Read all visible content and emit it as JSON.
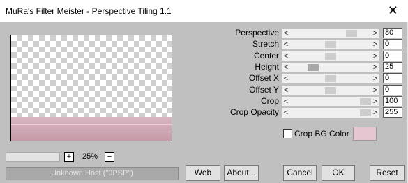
{
  "window": {
    "title": "MuRa's Filter Meister - Perspective Tiling 1.1",
    "close_glyph": "✕"
  },
  "preview": {
    "floor_color": "#d3a9b6"
  },
  "zoom": {
    "plus": "+",
    "minus": "−",
    "value": "25%"
  },
  "status": {
    "text": "Unknown Host (\"9PSP\")"
  },
  "controls": [
    {
      "label": "Perspective",
      "value": "80",
      "level": 0.8
    },
    {
      "label": "Stretch",
      "value": "0",
      "level": 0.5
    },
    {
      "label": "Center",
      "value": "0",
      "level": 0.5
    },
    {
      "label": "Height",
      "value": "25",
      "level": 0.25
    },
    {
      "label": "Offset X",
      "value": "0",
      "level": 0.5
    },
    {
      "label": "Offset Y",
      "value": "0",
      "level": 0.5
    },
    {
      "label": "Crop",
      "value": "100",
      "level": 1.0
    },
    {
      "label": "Crop Opacity",
      "value": "255",
      "level": 1.0
    }
  ],
  "crop_bg": {
    "label": "Crop BG Color",
    "color": "#e6c7d1",
    "checked": false
  },
  "buttons": {
    "web": "Web",
    "about": "About...",
    "cancel": "Cancel",
    "ok": "OK",
    "reset": "Reset"
  },
  "arrows": {
    "left": "<",
    "right": ">"
  }
}
